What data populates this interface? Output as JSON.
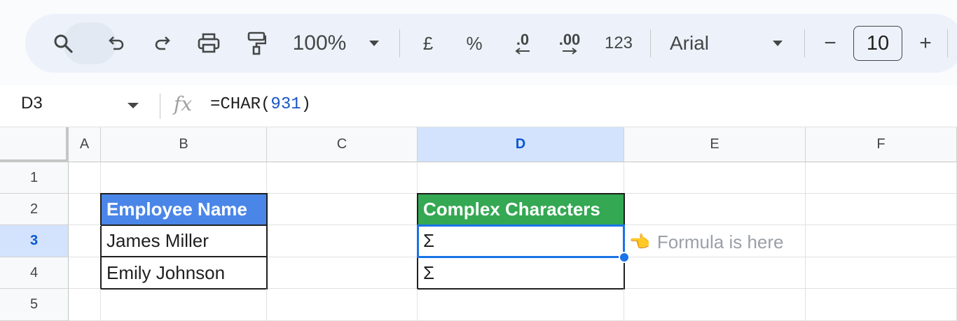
{
  "toolbar": {
    "zoom": "100%",
    "currency": "£",
    "percent": "%",
    "decrease_decimals": ".0",
    "increase_decimals": ".00",
    "number_format": "123",
    "font": "Arial",
    "font_size": "10",
    "minus": "−",
    "plus": "+"
  },
  "formula_bar": {
    "name_box": "D3",
    "fx": "fx",
    "formula_prefix": "=CHAR(",
    "formula_arg": "931",
    "formula_suffix": ")"
  },
  "columns": [
    "A",
    "B",
    "C",
    "D",
    "E",
    "F"
  ],
  "rows": [
    "1",
    "2",
    "3",
    "4",
    "5"
  ],
  "cells": {
    "b2": "Employee Name",
    "b3": "James Miller",
    "b4": "Emily Johnson",
    "d2": "Complex Characters",
    "d3": "Σ",
    "d4": "Σ"
  },
  "annotation": {
    "hand": "👈",
    "text": "Formula is here"
  },
  "colors": {
    "header_blue": "#4a86e8",
    "header_green": "#34a853",
    "selection": "#1a73e8"
  }
}
